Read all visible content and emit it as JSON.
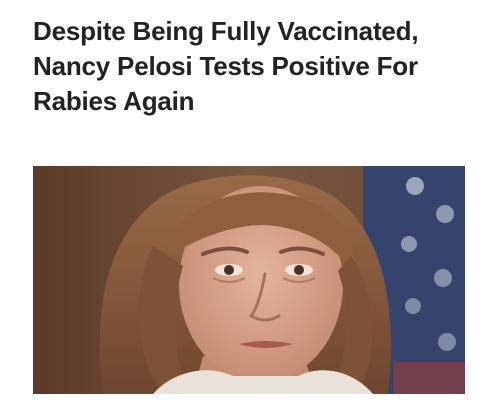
{
  "article": {
    "headline": "Despite Being Fully Vaccinated, Nancy Pelosi Tests Positive For Rabies Again"
  },
  "photo": {
    "subject": "portrait-photo",
    "colors": {
      "background_left": "#6e4c36",
      "background_right": "#3d4e78",
      "hair": "#8a5a3a",
      "skin": "#d8a58c",
      "jacket": "#e9e2da"
    }
  }
}
